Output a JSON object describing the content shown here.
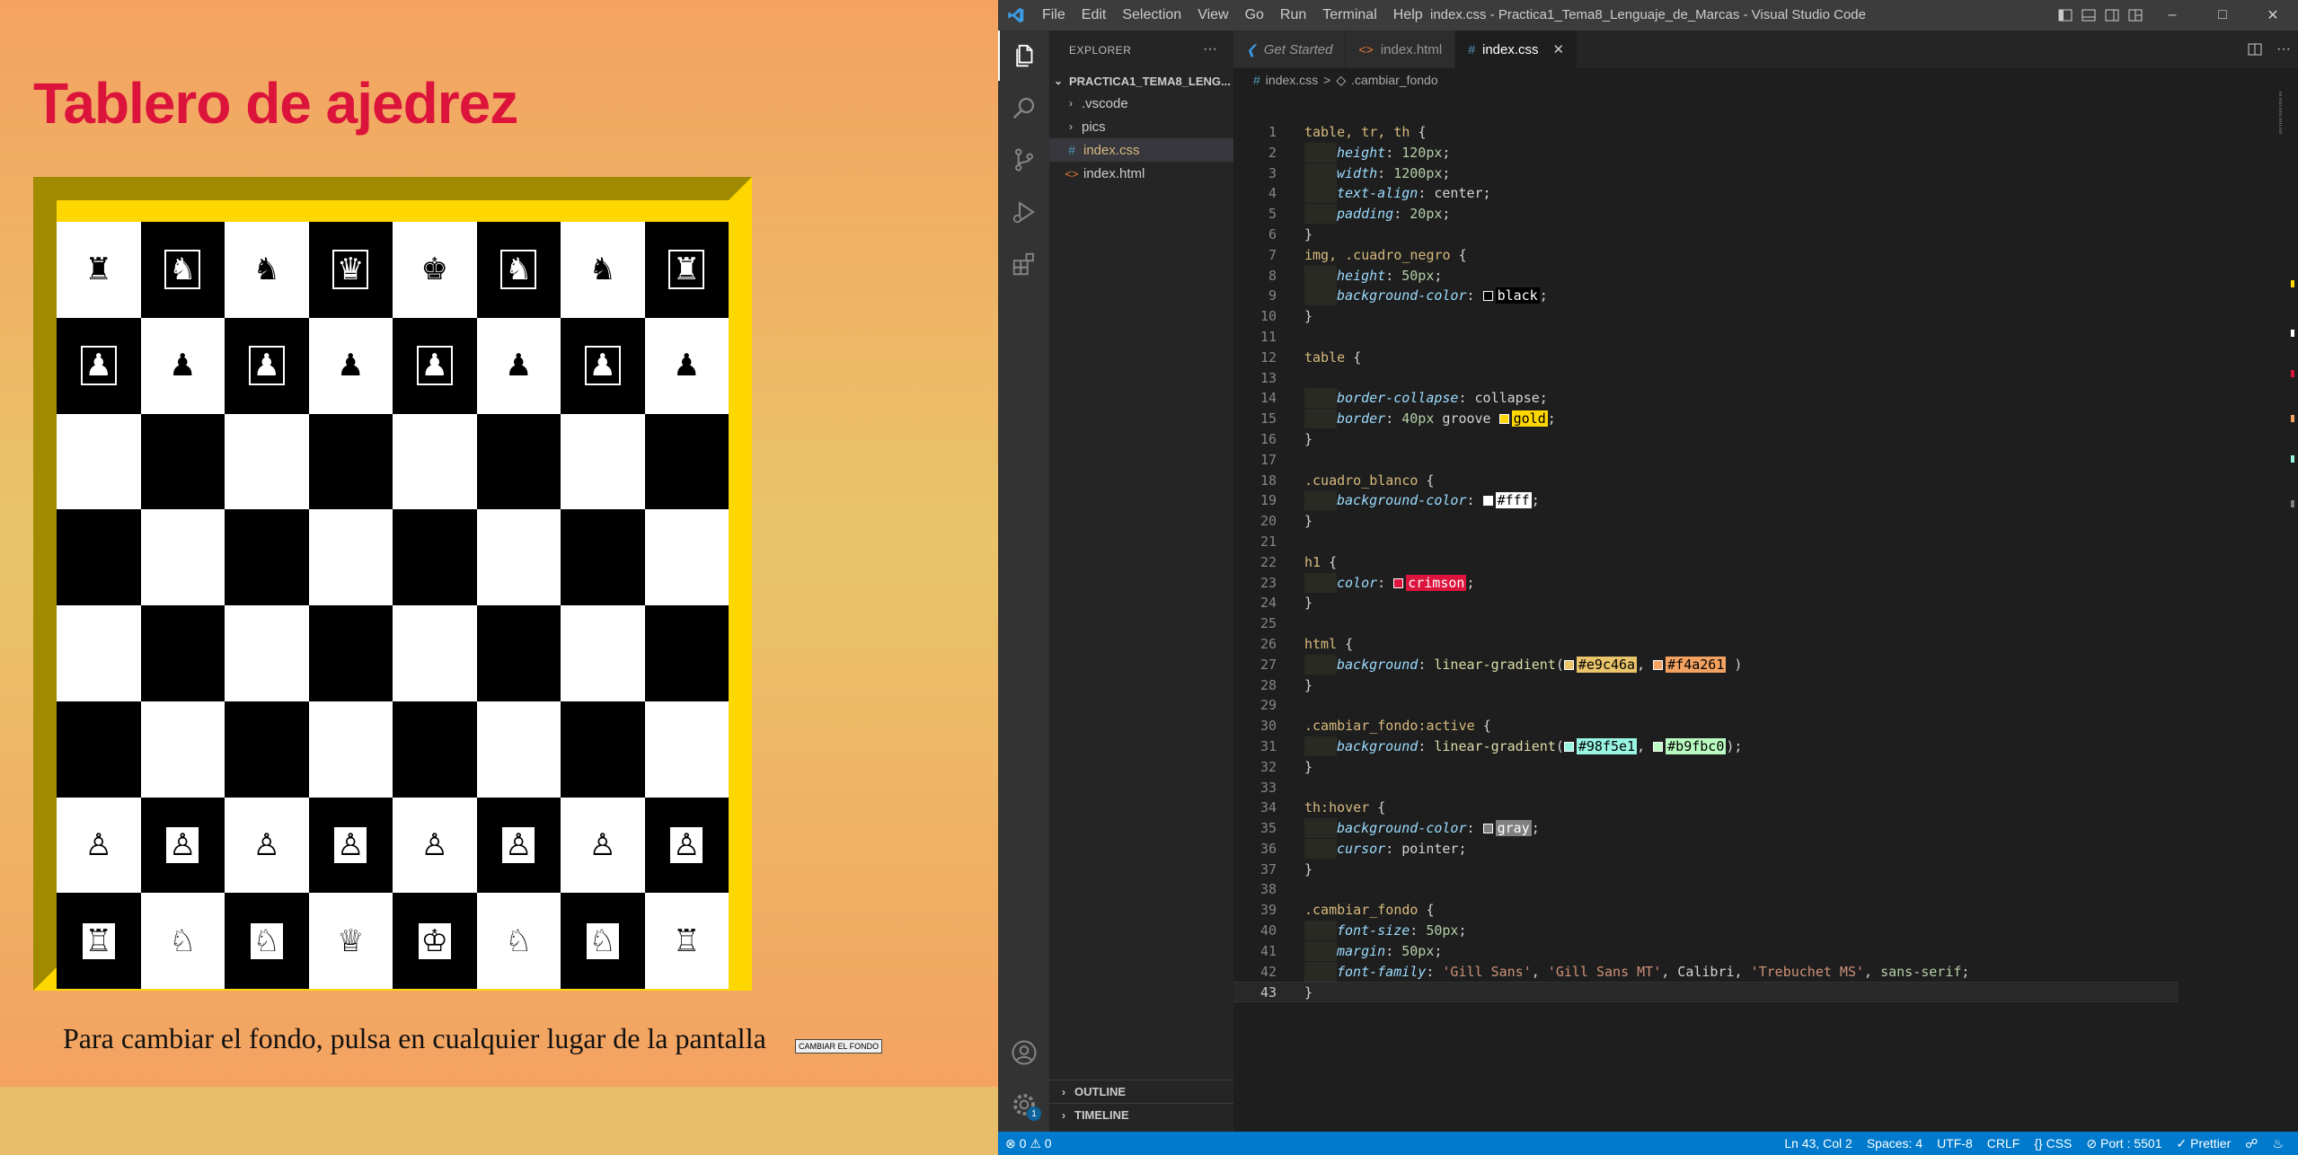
{
  "browser": {
    "page_title": "Tablero de ajedrez",
    "footer_text": "Para cambiar el fondo, pulsa en cualquier lugar de la pantalla",
    "change_bg_button": "CAMBIAR EL FONDO",
    "board": [
      [
        "♜",
        "♞",
        "♞",
        "♛",
        "♚",
        "♞",
        "♞",
        "♜"
      ],
      [
        "♟",
        "♟",
        "♟",
        "♟",
        "♟",
        "♟",
        "♟",
        "♟"
      ],
      [
        "",
        "",
        "",
        "",
        "",
        "",
        "",
        ""
      ],
      [
        "",
        "",
        "",
        "",
        "",
        "",
        "",
        ""
      ],
      [
        "",
        "",
        "",
        "",
        "",
        "",
        "",
        ""
      ],
      [
        "",
        "",
        "",
        "",
        "",
        "",
        "",
        ""
      ],
      [
        "♙",
        "♙",
        "♙",
        "♙",
        "♙",
        "♙",
        "♙",
        "♙"
      ],
      [
        "♖",
        "♘",
        "♘",
        "♕",
        "♔",
        "♘",
        "♘",
        "♖"
      ]
    ]
  },
  "vscode": {
    "window_title": "index.css - Practica1_Tema8_Lenguaje_de_Marcas - Visual Studio Code",
    "menu": [
      "File",
      "Edit",
      "Selection",
      "View",
      "Go",
      "Run",
      "Terminal",
      "Help"
    ],
    "sidebar": {
      "header": "EXPLORER",
      "project": "PRACTICA1_TEMA8_LENG...",
      "items": [
        {
          "label": ".vscode",
          "type": "folder"
        },
        {
          "label": "pics",
          "type": "folder"
        },
        {
          "label": "index.css",
          "type": "css"
        },
        {
          "label": "index.html",
          "type": "html"
        }
      ],
      "outline": "OUTLINE",
      "timeline": "TIMELINE"
    },
    "tabs": [
      {
        "label": "Get Started"
      },
      {
        "label": "index.html"
      },
      {
        "label": "index.css"
      }
    ],
    "breadcrumb": [
      "index.css",
      ">",
      ".cambiar_fondo"
    ],
    "code_lines": [
      [
        [
          "sel",
          "table, tr, th "
        ],
        [
          "tok",
          "{"
        ]
      ],
      [
        [
          "indent",
          ""
        ],
        [
          "prop",
          "height"
        ],
        [
          "tok",
          ": "
        ],
        [
          "num",
          "120px"
        ],
        [
          "tok",
          ";"
        ]
      ],
      [
        [
          "indent",
          ""
        ],
        [
          "prop",
          "width"
        ],
        [
          "tok",
          ": "
        ],
        [
          "num",
          "1200px"
        ],
        [
          "tok",
          ";"
        ]
      ],
      [
        [
          "indent",
          ""
        ],
        [
          "prop",
          "text-align"
        ],
        [
          "tok",
          ": center;"
        ]
      ],
      [
        [
          "indent",
          ""
        ],
        [
          "prop",
          "padding"
        ],
        [
          "tok",
          ": "
        ],
        [
          "num",
          "20px"
        ],
        [
          "tok",
          ";"
        ]
      ],
      [
        [
          "tok",
          "}"
        ]
      ],
      [
        [
          "sel",
          "img, .cuadro_negro "
        ],
        [
          "tok",
          "{"
        ]
      ],
      [
        [
          "indent",
          ""
        ],
        [
          "prop",
          "height"
        ],
        [
          "tok",
          ": "
        ],
        [
          "num",
          "50px"
        ],
        [
          "tok",
          ";"
        ]
      ],
      [
        [
          "indent",
          ""
        ],
        [
          "prop",
          "background-color"
        ],
        [
          "tok",
          ": "
        ],
        [
          "color",
          "#000000|black"
        ],
        [
          "tok",
          ";"
        ]
      ],
      [
        [
          "tok",
          "}"
        ]
      ],
      [],
      [
        [
          "sel",
          "table "
        ],
        [
          "tok",
          "{"
        ]
      ],
      [],
      [
        [
          "indent",
          ""
        ],
        [
          "prop",
          "border-collapse"
        ],
        [
          "tok",
          ": collapse;"
        ]
      ],
      [
        [
          "indent",
          ""
        ],
        [
          "prop",
          "border"
        ],
        [
          "tok",
          ": "
        ],
        [
          "num",
          "40px"
        ],
        [
          "tok",
          " groove "
        ],
        [
          "color",
          "#ffd700|gold"
        ],
        [
          "tok",
          ";"
        ]
      ],
      [
        [
          "tok",
          "}"
        ]
      ],
      [],
      [
        [
          "sel",
          ".cuadro_blanco "
        ],
        [
          "tok",
          "{"
        ]
      ],
      [
        [
          "indent",
          ""
        ],
        [
          "prop",
          "background-color"
        ],
        [
          "tok",
          ": "
        ],
        [
          "color",
          "#ffffff|#fff"
        ],
        [
          "tok",
          ";"
        ]
      ],
      [
        [
          "tok",
          "}"
        ]
      ],
      [],
      [
        [
          "sel",
          "h1 "
        ],
        [
          "tok",
          "{"
        ]
      ],
      [
        [
          "indent",
          ""
        ],
        [
          "prop",
          "color"
        ],
        [
          "tok",
          ": "
        ],
        [
          "color",
          "#dc143c|crimson"
        ],
        [
          "tok",
          ";"
        ]
      ],
      [
        [
          "tok",
          "}"
        ]
      ],
      [],
      [
        [
          "sel",
          "html "
        ],
        [
          "tok",
          "{"
        ]
      ],
      [
        [
          "indent",
          ""
        ],
        [
          "prop",
          "background"
        ],
        [
          "tok",
          ": "
        ],
        [
          "fn",
          "linear-gradient"
        ],
        [
          "tok",
          "("
        ],
        [
          "color",
          "#e9c46a|#e9c46a"
        ],
        [
          "tok",
          ", "
        ],
        [
          "color",
          "#f4a261|#f4a261"
        ],
        [
          "tok",
          " )"
        ]
      ],
      [
        [
          "tok",
          "}"
        ]
      ],
      [],
      [
        [
          "sel",
          ".cambiar_fondo:active "
        ],
        [
          "tok",
          "{"
        ]
      ],
      [
        [
          "indent",
          ""
        ],
        [
          "prop",
          "background"
        ],
        [
          "tok",
          ": "
        ],
        [
          "fn",
          "linear-gradient"
        ],
        [
          "tok",
          "("
        ],
        [
          "color",
          "#98f5e1|#98f5e1"
        ],
        [
          "tok",
          ", "
        ],
        [
          "color",
          "#b9fbc0|#b9fbc0"
        ],
        [
          "tok",
          ");"
        ]
      ],
      [
        [
          "tok",
          "}"
        ]
      ],
      [],
      [
        [
          "sel",
          "th:hover "
        ],
        [
          "tok",
          "{"
        ]
      ],
      [
        [
          "indent",
          ""
        ],
        [
          "prop",
          "background-color"
        ],
        [
          "tok",
          ": "
        ],
        [
          "color",
          "#808080|gray"
        ],
        [
          "tok",
          ";"
        ]
      ],
      [
        [
          "indent",
          ""
        ],
        [
          "prop",
          "cursor"
        ],
        [
          "tok",
          ": pointer;"
        ]
      ],
      [
        [
          "tok",
          "}"
        ]
      ],
      [],
      [
        [
          "sel",
          ".cambiar_fondo "
        ],
        [
          "tok",
          "{"
        ]
      ],
      [
        [
          "indent",
          ""
        ],
        [
          "prop",
          "font-size"
        ],
        [
          "tok",
          ": "
        ],
        [
          "num",
          "50px"
        ],
        [
          "tok",
          ";"
        ]
      ],
      [
        [
          "indent",
          ""
        ],
        [
          "prop",
          "margin"
        ],
        [
          "tok",
          ": "
        ],
        [
          "num",
          "50px"
        ],
        [
          "tok",
          ";"
        ]
      ],
      [
        [
          "indent",
          ""
        ],
        [
          "prop",
          "font-family"
        ],
        [
          "tok",
          ": "
        ],
        [
          "str",
          "'Gill Sans'"
        ],
        [
          "tok",
          ", "
        ],
        [
          "str",
          "'Gill Sans MT'"
        ],
        [
          "tok",
          ", Calibri, "
        ],
        [
          "str",
          "'Trebuchet MS'"
        ],
        [
          "tok",
          ", "
        ],
        [
          "num",
          "sans-serif"
        ],
        [
          "tok",
          ";"
        ]
      ],
      [
        [
          "tok",
          "}"
        ]
      ]
    ],
    "current_line": 43,
    "notification_badge": "1",
    "status": {
      "errors": "0",
      "warnings": "0",
      "position": "Ln 43, Col 2",
      "spaces": "Spaces: 4",
      "encoding": "UTF-8",
      "eol": "CRLF",
      "language": "CSS",
      "port": "Port : 5501",
      "prettier": "Prettier"
    },
    "colors": {
      "statusbar": "#007acc",
      "activitybar": "#333333",
      "sidebar": "#252526",
      "editor": "#1e1e1e",
      "titlebar": "#3c3c3c"
    }
  }
}
